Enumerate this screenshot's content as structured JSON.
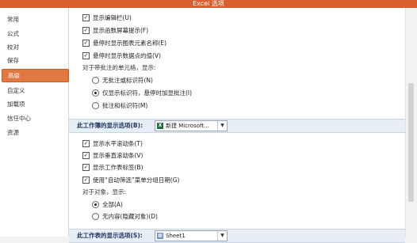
{
  "window": {
    "title": "Excel 选项"
  },
  "sidebar": {
    "items": [
      {
        "label": "常用"
      },
      {
        "label": "公式"
      },
      {
        "label": "校对"
      },
      {
        "label": "保存"
      },
      {
        "label": "高级",
        "active": true
      },
      {
        "label": "自定义"
      },
      {
        "label": "加载项"
      },
      {
        "label": "信任中心"
      },
      {
        "label": "资源"
      }
    ]
  },
  "options_top": [
    {
      "label": "显示编辑栏(U)",
      "checked": true
    },
    {
      "label": "显示函数屏幕提示(F)",
      "checked": true
    },
    {
      "label": "悬停时显示图表元素名称(E)",
      "checked": true
    },
    {
      "label": "悬停时显示数据点的值(V)",
      "checked": true
    }
  ],
  "comments_group": {
    "label": "对于带批注的单元格，显示:",
    "options": [
      {
        "label": "无批注或标识符(N)",
        "selected": false
      },
      {
        "label": "仅显示标识符，悬停时加显批注(I)",
        "selected": true
      },
      {
        "label": "批注和标识符(M)",
        "selected": false
      }
    ]
  },
  "workbook_section": {
    "title": "此工作簿的显示选项(B):",
    "dropdown_value": "新建 Microsoft...",
    "dropdown_icon": "excel-workbook-icon"
  },
  "workbook_options": [
    {
      "label": "显示水平滚动条(T)",
      "checked": true
    },
    {
      "label": "显示垂直滚动条(V)",
      "checked": true
    },
    {
      "label": "显示工作表标签(B)",
      "checked": true
    },
    {
      "label": "使用“自动筛选”菜单分组日期(G)",
      "checked": true
    }
  ],
  "objects_group": {
    "label": "对于对象，显示:",
    "options": [
      {
        "label": "全部(A)",
        "selected": true
      },
      {
        "label": "无内容(隐藏对象)(D)",
        "selected": false
      }
    ]
  },
  "sheet_section": {
    "title": "此工作表的显示选项(S):",
    "dropdown_value": "Sheet1"
  },
  "colors": {
    "title_bar": "#d8602f",
    "active_nav": "#e1783f",
    "section_bar": "#e8eef5"
  }
}
